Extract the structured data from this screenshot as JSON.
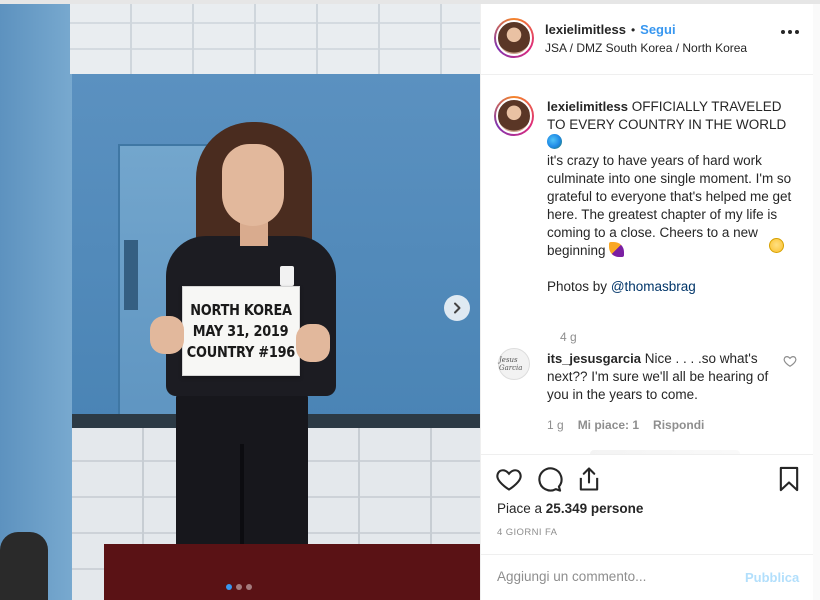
{
  "photo": {
    "sign_lines": [
      "NORTH KOREA",
      "MAY 31, 2019",
      "COUNTRY #196"
    ],
    "carousel": {
      "count": 3,
      "active_index": 0
    }
  },
  "header": {
    "username": "lexielimitless",
    "separator": "•",
    "follow_label": "Segui",
    "location": "JSA / DMZ South Korea / North Korea"
  },
  "caption": {
    "username": "lexielimitless",
    "line1": "OFFICIALLY TRAVELED TO EVERY COUNTRY IN THE WORLD",
    "body": "it's crazy to have years of hard work culminate into one single moment. I'm so grateful to everyone that's helped me get here. The greatest chapter of my life is coming to a close. Cheers to a new beginning",
    "photos_by": "Photos by",
    "mention": "@thomasbrag",
    "time_ago": "4 g"
  },
  "comments": [
    {
      "username": "its_jesusgarcia",
      "avatar_text": "Jesus Garcia",
      "text": "Nice . . . .so what's next?? I'm sure we'll all be hearing of you in the years to come.",
      "time_ago": "1 g",
      "likes_label": "Mi piace: 1",
      "reply_label": "Rispondi"
    }
  ],
  "actions": {
    "icons": [
      "heart-icon",
      "comment-icon",
      "share-icon",
      "bookmark-icon"
    ],
    "likes_prefix": "Piace a",
    "likes_count": "25.349",
    "likes_suffix": "persone",
    "date": "4 GIORNI FA"
  },
  "add_comment": {
    "placeholder": "Aggiungi un commento...",
    "publish_label": "Pubblica"
  },
  "colors": {
    "accent": "#3897f0",
    "publish_disabled": "#b2dffc",
    "muted": "#8e8e8e",
    "text": "#262626"
  }
}
